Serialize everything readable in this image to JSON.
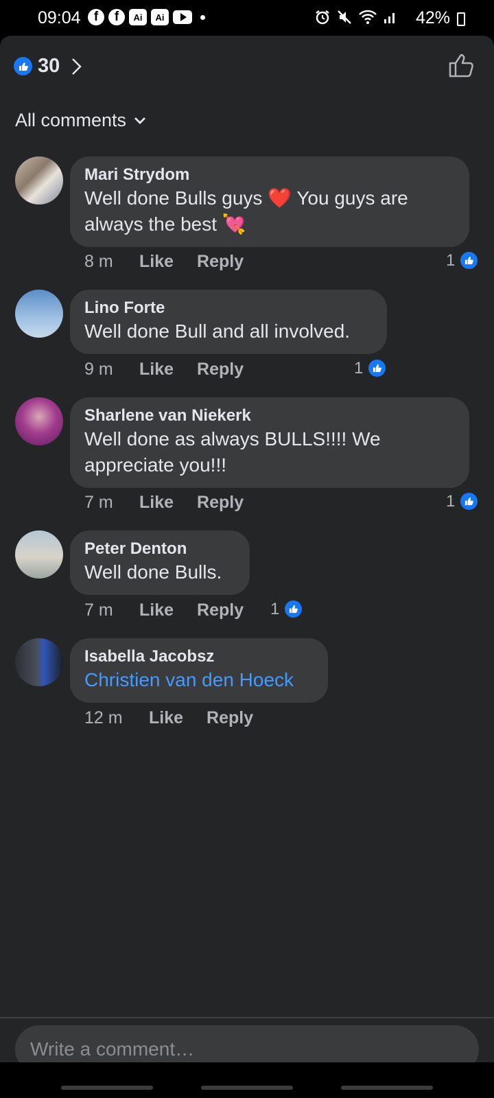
{
  "status_bar": {
    "time": "09:04",
    "ai_label": "Ai",
    "battery": "42%",
    "icons": [
      "facebook-icon",
      "facebook-icon",
      "ai-icon",
      "ai-icon",
      "youtube-icon",
      "alarm-icon",
      "mute-icon",
      "wifi-icon",
      "signal-icon",
      "battery-icon"
    ]
  },
  "header": {
    "reaction_count": "30",
    "sort_label": "All comments"
  },
  "comments": [
    {
      "author": "Mari Strydom",
      "text": "Well done Bulls guys ❤️ You guys are always the best 💘",
      "time": "8 m",
      "like": "Like",
      "reply": "Reply",
      "likes": "1"
    },
    {
      "author": "Lino Forte",
      "text": "Well done Bull and all involved.",
      "time": "9 m",
      "like": "Like",
      "reply": "Reply",
      "likes": "1"
    },
    {
      "author": "Sharlene van Niekerk",
      "text": "Well done as always BULLS!!!! We appreciate you!!!",
      "time": "7 m",
      "like": "Like",
      "reply": "Reply",
      "likes": "1"
    },
    {
      "author": "Peter Denton",
      "text": "Well done Bulls.",
      "time": "7 m",
      "like": "Like",
      "reply": "Reply",
      "likes": "1"
    },
    {
      "author": "Isabella Jacobsz",
      "text": "Christien van den Hoeck",
      "time": "12 m",
      "like": "Like",
      "reply": "Reply"
    }
  ],
  "composer": {
    "placeholder": "Write a comment…"
  },
  "colors": {
    "background": "#242527",
    "bubble": "#3a3b3c",
    "accent": "#1877f2",
    "link": "#4599ff"
  }
}
